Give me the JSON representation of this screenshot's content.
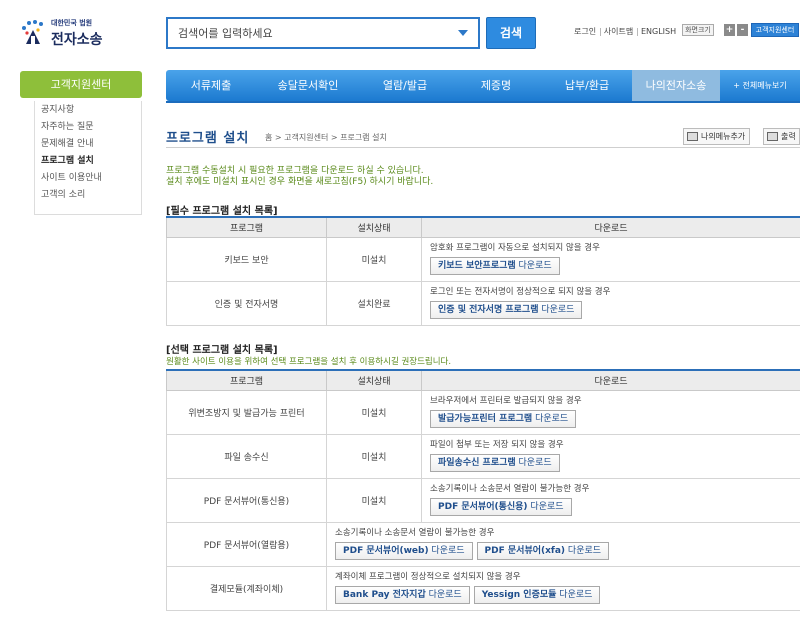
{
  "header": {
    "logo_sub": "대한민국 법원",
    "logo_main": "전자소송",
    "search_placeholder": "검색어를 입력하세요",
    "search_button": "검색",
    "util_links": [
      "로그인",
      "사이트맵",
      "ENGLISH"
    ],
    "font_label": "화면크기",
    "font_plus": "+",
    "font_minus": "-",
    "cs_link": "고객지원센터"
  },
  "sidebar": {
    "title": "고객지원센터",
    "items": [
      {
        "label": "공지사항"
      },
      {
        "label": "자주하는 질문"
      },
      {
        "label": "문제해결 안내"
      },
      {
        "label": "프로그램 설치"
      },
      {
        "label": "사이트 이용안내"
      },
      {
        "label": "고객의 소리"
      }
    ]
  },
  "nav": {
    "items": [
      {
        "label": "서류제출"
      },
      {
        "label": "송달문서확인"
      },
      {
        "label": "열람/발급"
      },
      {
        "label": "제증명"
      },
      {
        "label": "납부/환급"
      },
      {
        "label": "나의전자소송"
      }
    ],
    "more": "+ 전체메뉴보기"
  },
  "page": {
    "title": "프로그램 설치",
    "breadcrumb": "홈 > 고객지원센터 > 프로그램 설치",
    "menu_add": "나의메뉴추가",
    "print": "출력",
    "intro_1": "프로그램 수동설치 시 필요한 프로그램을 다운로드 하실 수 있습니다.",
    "intro_2": "설치 후에도 미설치 표시인 경우 화면을 새로고침(F5) 하시기 바랍니다."
  },
  "required": {
    "title": "[필수 프로그램 설치 목록]",
    "headers": [
      "프로그램",
      "설치상태",
      "다운로드"
    ],
    "rows": [
      {
        "program": "키보드 보안",
        "status": "미설치",
        "desc": "암호화 프로그램이 자동으로 설치되지 않을 경우",
        "btn_bold": "키보드 보안프로그램",
        "btn_norm": " 다운로드"
      },
      {
        "program": "인증 및 전자서명",
        "status": "설치완료",
        "desc": "로그인 또는 전자서명이 정상적으로 되지 않을 경우",
        "btn_bold": "인증 및 전자서명 프로그램",
        "btn_norm": " 다운로드"
      }
    ]
  },
  "optional": {
    "title": "[선택 프로그램 설치 목록]",
    "desc": "원활한 사이트 이용을 위하여 선택 프로그램을 설치 후 이용하시길 권장드립니다.",
    "headers": [
      "프로그램",
      "설치상태",
      "다운로드"
    ],
    "rows": [
      {
        "program": "위변조방지 및 발급가능 프린터",
        "status": "미설치",
        "desc": "브라우저에서 프린터로 발급되지 않을 경우",
        "btn_bold": "발급가능프린터 프로그램",
        "btn_norm": " 다운로드"
      },
      {
        "program": "파일 송수신",
        "status": "미설치",
        "desc": "파일이 첨부 또는 저장 되지 않을 경우",
        "btn_bold": "파일송수신 프로그램",
        "btn_norm": " 다운로드"
      },
      {
        "program": "PDF 문서뷰어(통신용)",
        "status": "미설치",
        "desc": "소송기록이나 소송문서 열람이 불가능한 경우",
        "btn_bold": "PDF 문서뷰어(통신용)",
        "btn_norm": " 다운로드"
      }
    ],
    "viewer_row": {
      "program": "PDF 문서뷰어(열람용)",
      "desc": "소송기록이나 소송문서 열람이 불가능한 경우",
      "btn1_bold": "PDF 문서뷰어(web)",
      "btn1_norm": " 다운로드",
      "btn2_bold": "PDF 문서뷰어(xfa)",
      "btn2_norm": " 다운로드"
    },
    "pay_row": {
      "program": "결제모듈(계좌이체)",
      "desc": "계좌이체 프로그램이 정상적으로 설치되지 않을 경우",
      "btn1_bold": "Bank Pay 전자지갑",
      "btn1_norm": " 다운로드",
      "btn2_bold": "Yessign 인증모듈",
      "btn2_norm": " 다운로드"
    }
  },
  "colors": {
    "accent": "#2c78c8",
    "sidebar_green": "#8ebf3a",
    "not_installed": "#d51919",
    "installed": "#1f4fb8",
    "intro_green": "#5a8a1a"
  }
}
